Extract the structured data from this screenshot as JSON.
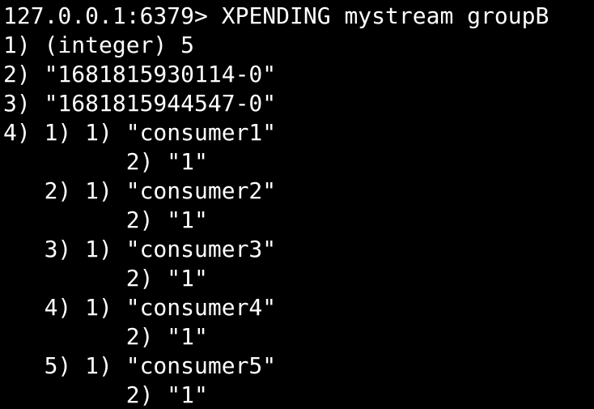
{
  "terminal": {
    "prompt": "127.0.0.1:6379>",
    "command": "XPENDING mystream groupB",
    "output": [
      "1) (integer) 5",
      "2) \"1681815930114-0\"",
      "3) \"1681815944547-0\"",
      "4) 1) 1) \"consumer1\"",
      "         2) \"1\"",
      "   2) 1) \"consumer2\"",
      "         2) \"1\"",
      "   3) 1) \"consumer3\"",
      "         2) \"1\"",
      "   4) 1) \"consumer4\"",
      "         2) \"1\"",
      "   5) 1) \"consumer5\"",
      "         2) \"1\""
    ]
  },
  "colors": {
    "background": "#000000",
    "foreground": "#ffffff"
  }
}
